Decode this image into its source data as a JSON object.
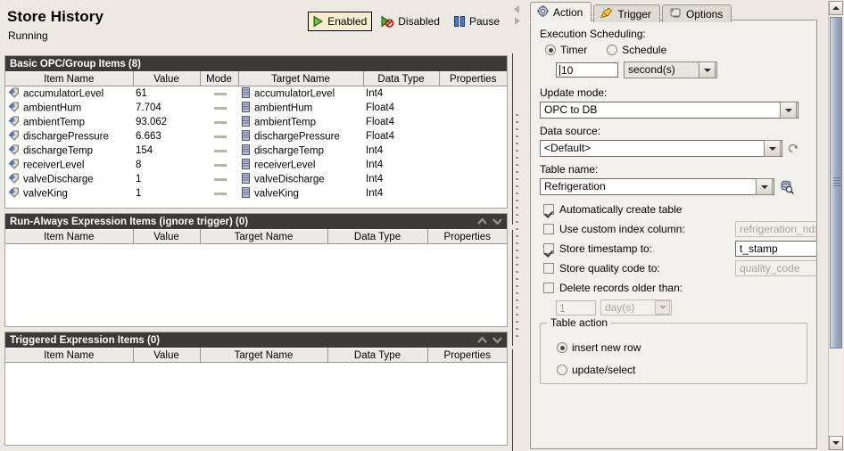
{
  "header": {
    "title": "Store History",
    "status": "Running",
    "modes": [
      {
        "label": "Enabled",
        "icon": "play-icon",
        "selected": true
      },
      {
        "label": "Disabled",
        "icon": "disabled-icon",
        "selected": false
      },
      {
        "label": "Pause",
        "icon": "pause-icon",
        "selected": false
      }
    ]
  },
  "sections": [
    {
      "title": "Basic OPC/Group Items (8)",
      "columns": [
        "Item Name",
        "Value",
        "Mode",
        "Target Name",
        "Data Type",
        "Properties"
      ],
      "rows": [
        {
          "item": "accumulatorLevel",
          "value": "61",
          "mode": "-",
          "target": "accumulatorLevel",
          "type": "Int4",
          "props": ""
        },
        {
          "item": "ambientHum",
          "value": "7.704",
          "mode": "-",
          "target": "ambientHum",
          "type": "Float4",
          "props": ""
        },
        {
          "item": "ambientTemp",
          "value": "93.062",
          "mode": "-",
          "target": "ambientTemp",
          "type": "Float4",
          "props": ""
        },
        {
          "item": "dischargePressure",
          "value": "6.663",
          "mode": "-",
          "target": "dischargePressure",
          "type": "Float4",
          "props": ""
        },
        {
          "item": "dischargeTemp",
          "value": "154",
          "mode": "-",
          "target": "dischargeTemp",
          "type": "Int4",
          "props": ""
        },
        {
          "item": "receiverLevel",
          "value": "8",
          "mode": "-",
          "target": "receiverLevel",
          "type": "Int4",
          "props": ""
        },
        {
          "item": "valveDischarge",
          "value": "1",
          "mode": "-",
          "target": "valveDischarge",
          "type": "Int4",
          "props": ""
        },
        {
          "item": "valveKing",
          "value": "1",
          "mode": "-",
          "target": "valveKing",
          "type": "Int4",
          "props": ""
        }
      ]
    },
    {
      "title": "Run-Always Expression Items (ignore trigger) (0)",
      "columns": [
        "Item Name",
        "Value",
        "Target Name",
        "Data Type",
        "Properties"
      ],
      "rows": []
    },
    {
      "title": "Triggered Expression Items (0)",
      "columns": [
        "Item Name",
        "Value",
        "Target Name",
        "Data Type",
        "Properties"
      ],
      "rows": []
    }
  ],
  "right": {
    "tabs": [
      {
        "label": "Action",
        "icon": "gear-icon",
        "active": true
      },
      {
        "label": "Trigger",
        "icon": "pencil-icon",
        "active": false
      },
      {
        "label": "Options",
        "icon": "scroll-icon",
        "active": false
      }
    ],
    "scheduling": {
      "label": "Execution Scheduling:",
      "timer_label": "Timer",
      "schedule_label": "Schedule",
      "mode": "Timer",
      "interval_value": "10",
      "interval_unit": "second(s)"
    },
    "update_mode": {
      "label": "Update mode:",
      "value": "OPC to DB"
    },
    "data_source": {
      "label": "Data source:",
      "value": "<Default>",
      "refresh_icon": "refresh-icon"
    },
    "table_name": {
      "label": "Table name:",
      "value": "Refrigeration",
      "browse_icon": "database-search-icon"
    },
    "options": [
      {
        "label": "Automatically create table",
        "checked": true,
        "field": null
      },
      {
        "label": "Use custom index column:",
        "checked": false,
        "field": {
          "value": "refrigeration_ndx",
          "enabled": false
        }
      },
      {
        "label": "Store timestamp to:",
        "checked": true,
        "field": {
          "value": "t_stamp",
          "enabled": true
        }
      },
      {
        "label": "Store quality code to:",
        "checked": false,
        "field": {
          "value": "quality_code",
          "enabled": false
        }
      },
      {
        "label": "Delete records older than:",
        "checked": false,
        "field": null
      }
    ],
    "delete_age": {
      "value": "1",
      "unit": "day(s)",
      "enabled": false
    },
    "table_action": {
      "legend": "Table action",
      "selected": "insert new row",
      "options": [
        "insert new row",
        "update/select"
      ]
    }
  },
  "colors": {
    "panel_bg": "#ece9e2",
    "tab_bg": "#f2f0ea",
    "section_header_bg": "#3b3a37",
    "selected_button_bg": "#faeecd",
    "accent_green": "#2e9b2e",
    "accent_blue": "#3a62a8",
    "scrollbar_thumb": "#9aa9bd"
  }
}
